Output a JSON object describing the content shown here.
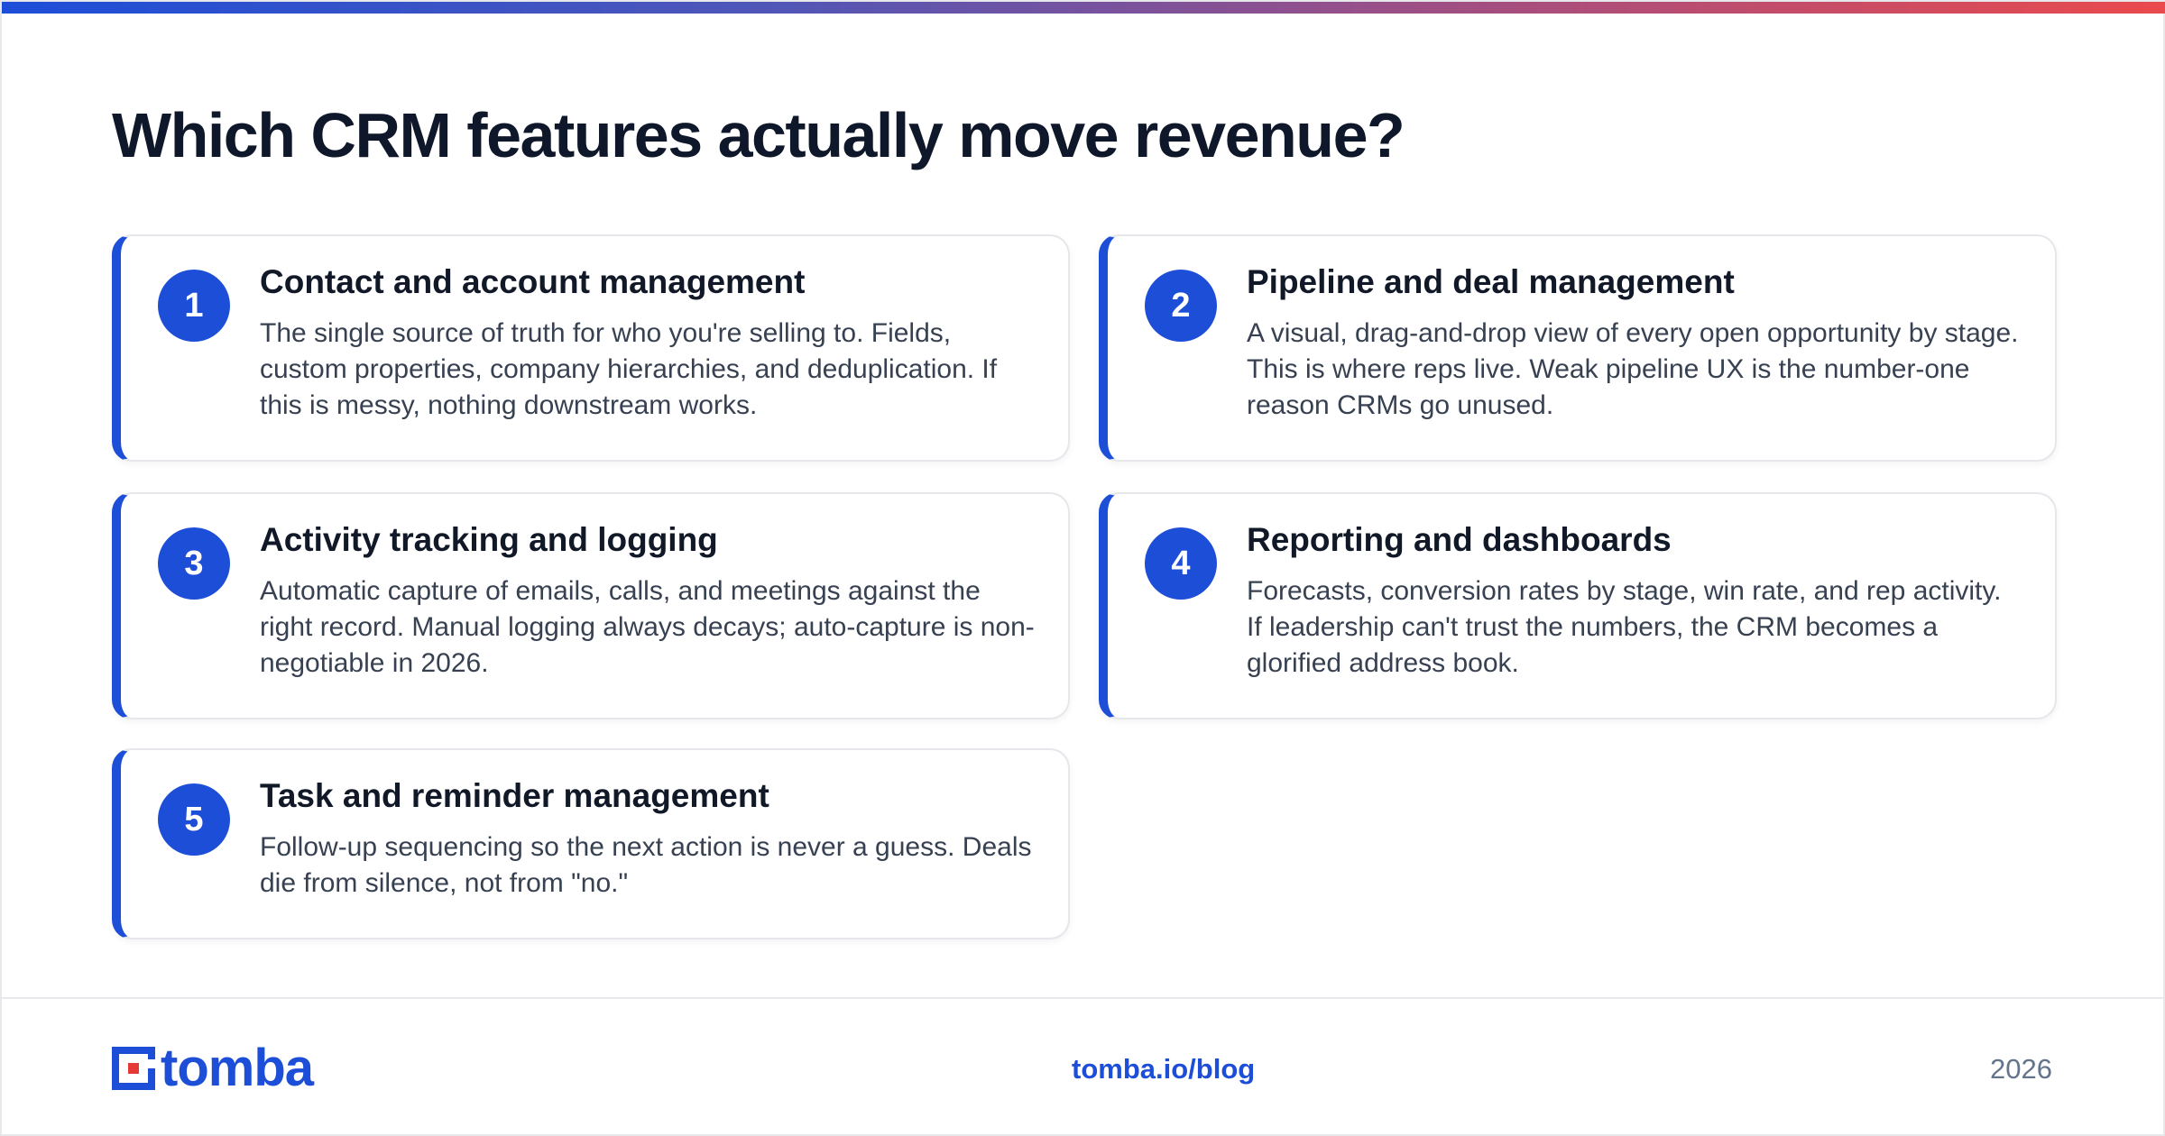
{
  "header": {
    "title": "Which CRM features actually move revenue?"
  },
  "features": [
    {
      "number": "1",
      "title": "Contact and account management",
      "description": "The single source of truth for who you're selling to. Fields, custom properties, company hierarchies, and deduplication. If this is messy, nothing downstream works."
    },
    {
      "number": "2",
      "title": "Pipeline and deal management",
      "description": "A visual, drag-and-drop view of every open opportunity by stage. This is where reps live. Weak pipeline UX is the number-one reason CRMs go unused."
    },
    {
      "number": "3",
      "title": "Activity tracking and logging",
      "description": "Automatic capture of emails, calls, and meetings against the right record. Manual logging always decays; auto-capture is non-negotiable in 2026."
    },
    {
      "number": "4",
      "title": "Reporting and dashboards",
      "description": "Forecasts, conversion rates by stage, win rate, and rep activity. If leadership can't trust the numbers, the CRM becomes a glorified address book."
    },
    {
      "number": "5",
      "title": "Task and reminder management",
      "description": "Follow-up sequencing so the next action is never a guess. Deals die from silence, not from \"no.\""
    }
  ],
  "footer": {
    "logo_text": "tomba",
    "link": "tomba.io/blog",
    "year": "2026"
  },
  "colors": {
    "accent": "#1d4ed8",
    "logo_red": "#e53935",
    "title": "#0f172a",
    "body_text": "#374151",
    "muted": "#64748b"
  }
}
